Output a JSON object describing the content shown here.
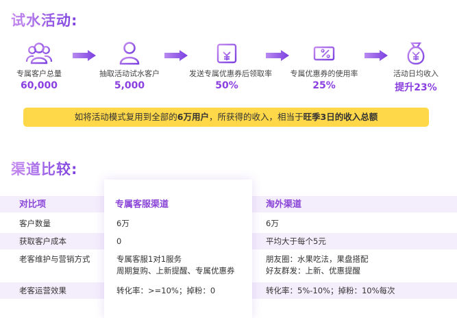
{
  "section1_title": "试水活动:",
  "section2_title": "渠道比较:",
  "funnel": [
    {
      "icon": "people-group-icon",
      "label": "专属客户总量",
      "value": "60,000"
    },
    {
      "icon": "person-icon",
      "label": "抽取活动试水客户",
      "value": "5,000"
    },
    {
      "icon": "coupon-yen-icon",
      "label": "发送专属优惠券后领取率",
      "value": "50%"
    },
    {
      "icon": "ticket-percent-icon",
      "label": "专属优惠券的使用率",
      "value": "25%"
    },
    {
      "icon": "money-bag-icon",
      "label": "活动日均收入",
      "value": "提升23%"
    }
  ],
  "banner": {
    "p1": "如将活动模式复用到全部的",
    "b1": "6万用户",
    "p2": "，所获得的收入，相当于",
    "b2": "旺季3日的收入总额"
  },
  "table": {
    "headers": [
      "对比项",
      "专属客服渠道",
      "淘外渠道"
    ],
    "rows": [
      {
        "item": "客户数量",
        "a": [
          "6万"
        ],
        "b": [
          "6万"
        ]
      },
      {
        "item": "获取客户成本",
        "a": [
          "0"
        ],
        "b": [
          "平均大于每个5元"
        ]
      },
      {
        "item": "老客维护与营销方式",
        "a": [
          "专属客服1对1服务",
          "周期复购、上新提醒、专属优惠券"
        ],
        "b": [
          "朋友圈：水果吃法，果盘搭配",
          "好友群发：上新、优惠提醒"
        ]
      },
      {
        "item": "老客运营效果",
        "a": [
          "转化率：>=10%；掉粉：0"
        ],
        "b": [
          "转化率：5%-10%；掉粉：10%每次"
        ]
      }
    ]
  },
  "colors": {
    "accent": "#8a3fe0",
    "banner": "#ffd84a",
    "row_shade": "#f4eefc"
  }
}
